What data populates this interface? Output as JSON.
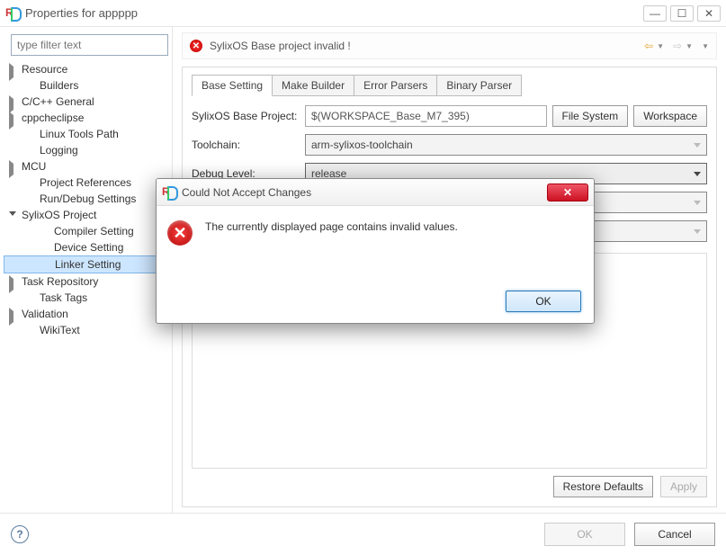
{
  "window": {
    "title": "Properties for appppp"
  },
  "filter": {
    "placeholder": "type filter text"
  },
  "tree": {
    "items": [
      {
        "label": "Resource",
        "level": 1,
        "arrow": "right"
      },
      {
        "label": "Builders",
        "level": 2
      },
      {
        "label": "C/C++ General",
        "level": 1,
        "arrow": "right"
      },
      {
        "label": "cppcheclipse",
        "level": 1,
        "arrow": "right"
      },
      {
        "label": "Linux Tools Path",
        "level": 2
      },
      {
        "label": "Logging",
        "level": 2
      },
      {
        "label": "MCU",
        "level": 1,
        "arrow": "right"
      },
      {
        "label": "Project References",
        "level": 2
      },
      {
        "label": "Run/Debug Settings",
        "level": 2
      },
      {
        "label": "SylixOS Project",
        "level": 1,
        "arrow": "down"
      },
      {
        "label": "Compiler Setting",
        "level": 3
      },
      {
        "label": "Device Setting",
        "level": 3
      },
      {
        "label": "Linker Setting",
        "level": 3,
        "selected": true
      },
      {
        "label": "Task Repository",
        "level": 1,
        "arrow": "right"
      },
      {
        "label": "Task Tags",
        "level": 2
      },
      {
        "label": "Validation",
        "level": 1,
        "arrow": "right"
      },
      {
        "label": "WikiText",
        "level": 2
      }
    ]
  },
  "banner": {
    "text": "SylixOS Base project invalid !"
  },
  "tabs": {
    "items": [
      {
        "label": "Base Setting",
        "active": true
      },
      {
        "label": "Make Builder"
      },
      {
        "label": "Error Parsers"
      },
      {
        "label": "Binary Parser"
      }
    ]
  },
  "form": {
    "base_label": "SylixOS Base Project:",
    "base_value": "$(WORKSPACE_Base_M7_395)",
    "file_system": "File System",
    "workspace": "Workspace",
    "toolchain_label": "Toolchain:",
    "toolchain_value": "arm-sylixos-toolchain",
    "debug_label": "Debug Level:",
    "debug_value": "release"
  },
  "buttons": {
    "restore": "Restore Defaults",
    "apply": "Apply",
    "ok": "OK",
    "cancel": "Cancel"
  },
  "dialog": {
    "title": "Could Not Accept Changes",
    "message": "The currently displayed page contains invalid values.",
    "ok": "OK"
  }
}
